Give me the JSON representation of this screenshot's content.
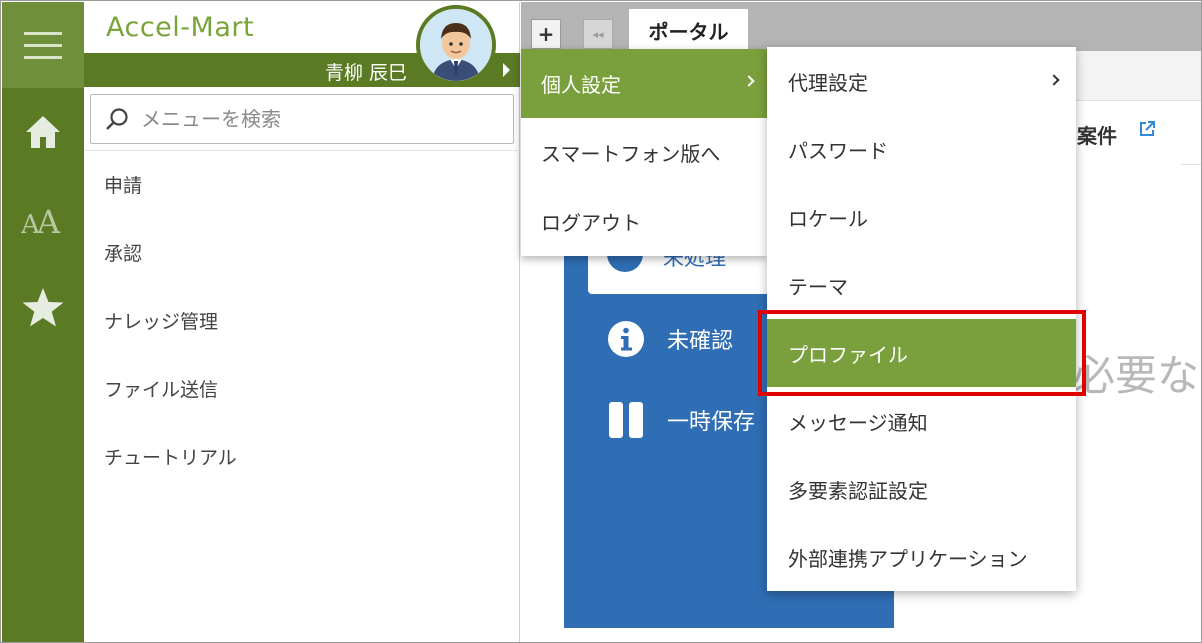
{
  "brand": "Accel-Mart",
  "user": {
    "name": "青柳 辰巳"
  },
  "search": {
    "placeholder": "メニューを検索"
  },
  "menu": {
    "items": [
      "申請",
      "承認",
      "ナレッジ管理",
      "ファイル送信",
      "チュートリアル"
    ]
  },
  "rail": {
    "icons": [
      "hamburger-icon",
      "home-icon",
      "font-size-icon",
      "star-icon"
    ]
  },
  "tabs": {
    "add_label": "+",
    "collapse_label": "◂◂",
    "active": "ポータル"
  },
  "portal": {
    "case_title": "案件",
    "unprocessed": "未処理",
    "unconfirmed": "未確認",
    "draft": "一時保存",
    "big_text": "必要な"
  },
  "user_menu": {
    "items": [
      {
        "label": "個人設定",
        "active": true,
        "submenu": true
      },
      {
        "label": "スマートフォン版へ",
        "active": false
      },
      {
        "label": "ログアウト",
        "active": false
      }
    ]
  },
  "personal_settings_menu": {
    "items": [
      {
        "label": "代理設定",
        "submenu": true
      },
      {
        "label": "パスワード"
      },
      {
        "label": "ロケール"
      },
      {
        "label": "テーマ"
      },
      {
        "label": "プロファイル",
        "active": true,
        "highlighted": true
      },
      {
        "label": "メッセージ通知"
      },
      {
        "label": "多要素認証設定"
      },
      {
        "label": "外部連携アプリケーション"
      }
    ]
  },
  "colors": {
    "rail": "#5a7a23",
    "brand": "#7aa33a",
    "menu_active": "#7aa03d",
    "portal_blue": "#2f6db4",
    "highlight": "#e00000"
  }
}
